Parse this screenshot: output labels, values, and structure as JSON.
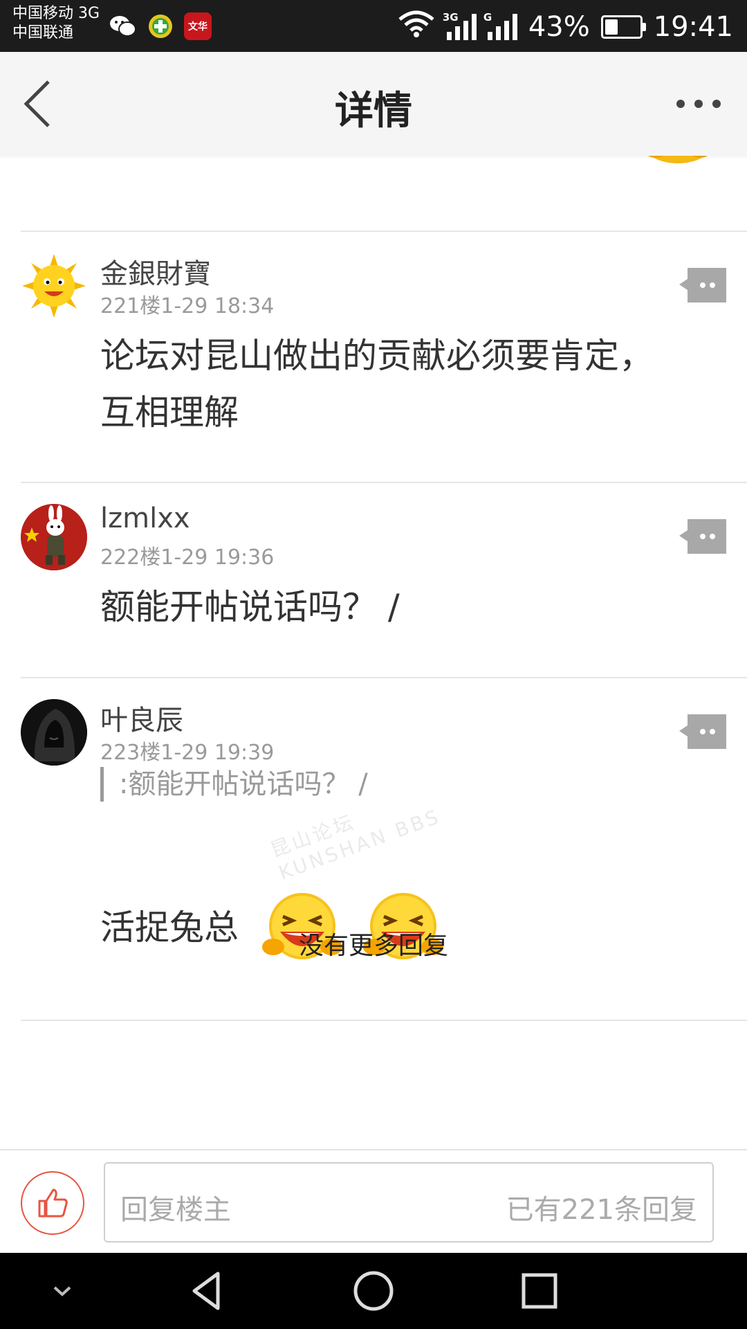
{
  "status_bar": {
    "carrier_1": "中国移动 3G",
    "carrier_2": "中国联通",
    "app_icon_wenhua": "文华",
    "sig_tag_1": "3G",
    "sig_tag_2": "G",
    "battery_percent": "43%",
    "battery_level": 0.43,
    "time": "19:41"
  },
  "header": {
    "title": "详情"
  },
  "posts": [
    {
      "username": "金銀財寶",
      "meta": "221楼1-29 18:34",
      "text_line1": "论坛对昆山做出的贡献必须要肯定，",
      "text_line2": "互相理解",
      "avatar_icon": "sun-avatar"
    },
    {
      "username": "lzmlxx",
      "meta": "222楼1-29 19:36",
      "text": "额能开帖说话吗？ /",
      "avatar_icon": "rabbit-avatar"
    },
    {
      "username": "叶良辰",
      "meta": "223楼1-29 19:39",
      "quote": ":额能开帖说话吗？ /",
      "text": "活捉兔总",
      "avatar_icon": "hooded-avatar"
    }
  ],
  "watermark_cn": "昆山论坛",
  "watermark_en": "KUNSHAN BBS",
  "no_more": "没有更多回复",
  "bottom_bar": {
    "input_placeholder": "回复楼主",
    "reply_count": "已有221条回复"
  },
  "colors": {
    "accent": "#e8543f",
    "header_bg": "#f5f5f5",
    "text_gray": "#9a9a9a"
  }
}
